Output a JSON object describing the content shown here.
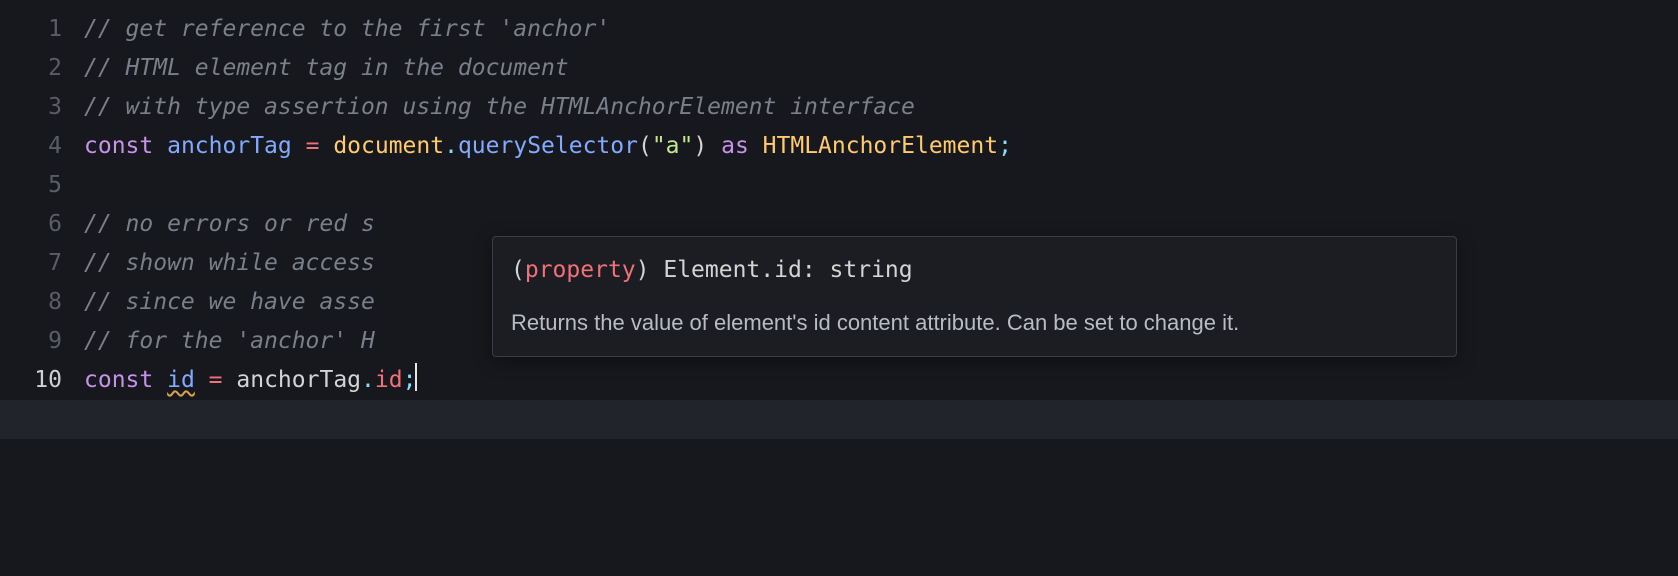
{
  "lines": {
    "l1": {
      "num": "1",
      "comment": "// get reference to the first 'anchor'"
    },
    "l2": {
      "num": "2",
      "comment": "// HTML element tag in the document"
    },
    "l3": {
      "num": "3",
      "comment": "// with type assertion using the HTMLAnchorElement interface"
    },
    "l4": {
      "num": "4",
      "kw_const": "const",
      "name": "anchorTag",
      "eq": "=",
      "obj": "document",
      "dot1": ".",
      "fn": "querySelector",
      "lp": "(",
      "str": "\"a\"",
      "rp": ")",
      "kw_as": "as",
      "type": "HTMLAnchorElement",
      "semi": ";"
    },
    "l5": {
      "num": "5"
    },
    "l6": {
      "num": "6",
      "comment": "// no errors or red s"
    },
    "l7": {
      "num": "7",
      "comment": "// shown while access"
    },
    "l8": {
      "num": "8",
      "comment": "// since we have asse"
    },
    "l9": {
      "num": "9",
      "comment": "// for the 'anchor' H"
    },
    "l10": {
      "num": "10",
      "kw_const": "const",
      "name": "id",
      "eq": "=",
      "obj": "anchorTag",
      "dot": ".",
      "prop": "id",
      "semi": ";"
    }
  },
  "hover": {
    "sig_open": "(",
    "sig_kind": "property",
    "sig_close": ") ",
    "sig_qual": "Element.",
    "sig_id": "id",
    "sig_colon": ": ",
    "sig_type": "string",
    "doc": "Returns the value of element's id content attribute. Can be set to change it."
  }
}
